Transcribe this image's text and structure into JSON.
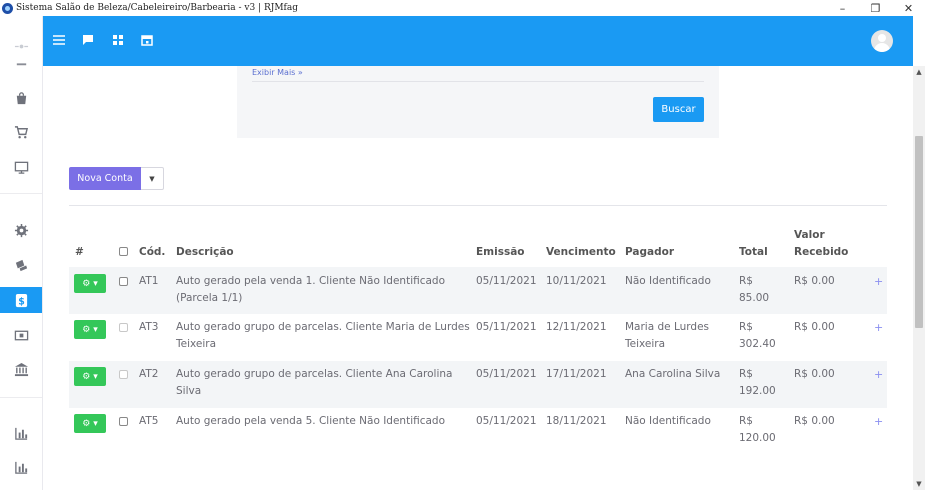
{
  "window": {
    "title": "Sistema Salão de Beleza/Cabeleireiro/Barbearia - v3 | RJMfag",
    "minimize": "–",
    "restore": "❐",
    "close": "✕"
  },
  "filter": {
    "more_link": "Exibir Mais »",
    "search_button": "Buscar"
  },
  "actions": {
    "new_account": "Nova Conta",
    "caret": "▼"
  },
  "table": {
    "headers": {
      "hash": "#",
      "code": "Cód.",
      "description": "Descrição",
      "issue": "Emissão",
      "due": "Vencimento",
      "payer": "Pagador",
      "total": "Total",
      "received_line1": "Valor",
      "received_line2": "Recebido"
    },
    "rows": [
      {
        "code": "AT1",
        "desc1": "Auto gerado pela venda 1. Cliente Não Identificado",
        "desc2": "(Parcela 1/1)",
        "issue": "05/11/2021",
        "due": "10/11/2021",
        "payer1": "Não Identificado",
        "payer2": "",
        "total1": "R$",
        "total2": "85.00",
        "received": "R$ 0.00",
        "plus": "+"
      },
      {
        "code": "AT3",
        "desc1": "Auto gerado grupo de parcelas. Cliente Maria de Lurdes",
        "desc2": "Teixeira",
        "issue": "05/11/2021",
        "due": "12/11/2021",
        "payer1": "Maria de Lurdes",
        "payer2": "Teixeira",
        "total1": "R$",
        "total2": "302.40",
        "received": "R$ 0.00",
        "plus": "+"
      },
      {
        "code": "AT2",
        "desc1": "Auto gerado grupo de parcelas. Cliente Ana Carolina",
        "desc2": "Silva",
        "issue": "05/11/2021",
        "due": "17/11/2021",
        "payer1": "Ana Carolina Silva",
        "payer2": "",
        "total1": "R$",
        "total2": "192.00",
        "received": "R$ 0.00",
        "plus": "+"
      },
      {
        "code": "AT5",
        "desc1": "Auto gerado pela venda 5. Cliente Não Identificado",
        "desc2": "",
        "issue": "05/11/2021",
        "due": "18/11/2021",
        "payer1": "Não Identificado",
        "payer2": "",
        "total1": "R$",
        "total2": "120.00",
        "received": "R$ 0.00",
        "plus": "+"
      }
    ],
    "gear_label": "⚙ ▾"
  },
  "colors": {
    "primary": "#1a9af3",
    "new_button": "#7b6fe6",
    "gear_button": "#34c759"
  }
}
